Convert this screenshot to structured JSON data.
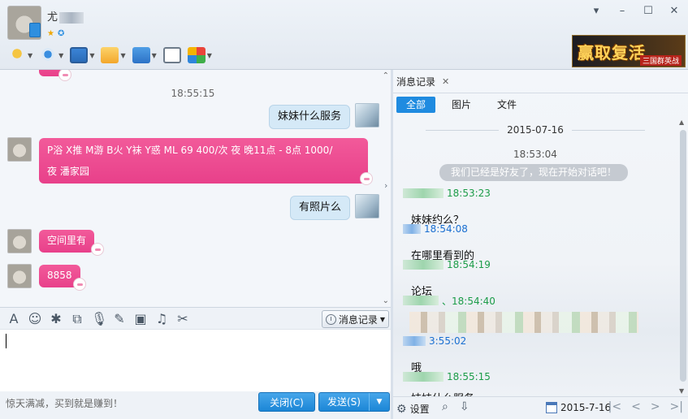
{
  "header": {
    "contact_name": "尤",
    "window_controls": [
      "▾",
      "–",
      "☐",
      "✕"
    ],
    "toolbar_icons": [
      "microphone-icon",
      "camera-icon",
      "screen-share-icon",
      "file-transfer-icon",
      "remote-desktop-icon",
      "message-icon",
      "apps-icon"
    ],
    "banner_title": "赢取复活",
    "banner_sub": "三国群英战"
  },
  "chat": {
    "timestamp": "18:55:15",
    "messages": [
      {
        "side": "right",
        "text": "妹妹什么服务"
      },
      {
        "side": "left",
        "line1": "P浴 X推 M游 B火 Y袜 Y惑 ML 69 400/次 夜 晚11点 - 8点 1000/",
        "line2": "夜 潘家园"
      },
      {
        "side": "right",
        "text": "有照片么"
      },
      {
        "side": "left",
        "text": "空间里有"
      },
      {
        "side": "left",
        "text": "8858"
      }
    ]
  },
  "input_toolbar": {
    "history_label": "消息记录"
  },
  "footer": {
    "ad_text": "惊天满减，买到就是赚到！",
    "close_label": "关闭(C)",
    "send_label": "发送(S)"
  },
  "history": {
    "tab_label": "消息记录",
    "filters": [
      "全部",
      "图片",
      "文件"
    ],
    "date": "2015-07-16",
    "time0": "18:53:04",
    "system_notice": "我们已经是好友了，现在开始对话吧！",
    "entries": [
      {
        "time": "18:53:23",
        "color": "green",
        "text": "妹妹约么？"
      },
      {
        "time": "18:54:08",
        "color": "blue",
        "text": "在哪里看到的"
      },
      {
        "time": "18:54:19",
        "color": "green",
        "text": "论坛"
      },
      {
        "time": "、18:54:40",
        "color": "green",
        "text": ""
      },
      {
        "time": "3:55:02",
        "color": "blue",
        "text": "哦"
      },
      {
        "time": "18:55:15",
        "color": "green",
        "text": "妹妹什么服务"
      }
    ],
    "settings_label": "设置",
    "bottom_date": "2015-7-16"
  }
}
